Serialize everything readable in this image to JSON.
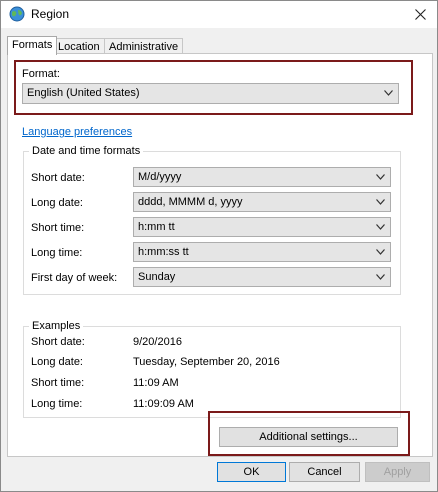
{
  "window": {
    "title": "Region"
  },
  "tabs": [
    {
      "label": "Formats",
      "active": true
    },
    {
      "label": "Location",
      "active": false
    },
    {
      "label": "Administrative",
      "active": false
    }
  ],
  "format": {
    "label": "Format:",
    "value": "English (United States)"
  },
  "language_link": "Language preferences",
  "date_time": {
    "title": "Date and time formats",
    "rows": [
      {
        "label": "Short date:",
        "value": "M/d/yyyy"
      },
      {
        "label": "Long date:",
        "value": "dddd, MMMM d, yyyy"
      },
      {
        "label": "Short time:",
        "value": "h:mm tt"
      },
      {
        "label": "Long time:",
        "value": "h:mm:ss tt"
      },
      {
        "label": "First day of week:",
        "value": "Sunday"
      }
    ]
  },
  "examples": {
    "title": "Examples",
    "rows": [
      {
        "label": "Short date:",
        "value": "9/20/2016"
      },
      {
        "label": "Long date:",
        "value": "Tuesday, September 20, 2016"
      },
      {
        "label": "Short time:",
        "value": "11:09 AM"
      },
      {
        "label": "Long time:",
        "value": "11:09:09 AM"
      }
    ]
  },
  "buttons": {
    "additional": "Additional settings...",
    "ok": "OK",
    "cancel": "Cancel",
    "apply": "Apply"
  },
  "colors": {
    "highlight_box": "#7b1a1a",
    "link": "#0066cc"
  }
}
